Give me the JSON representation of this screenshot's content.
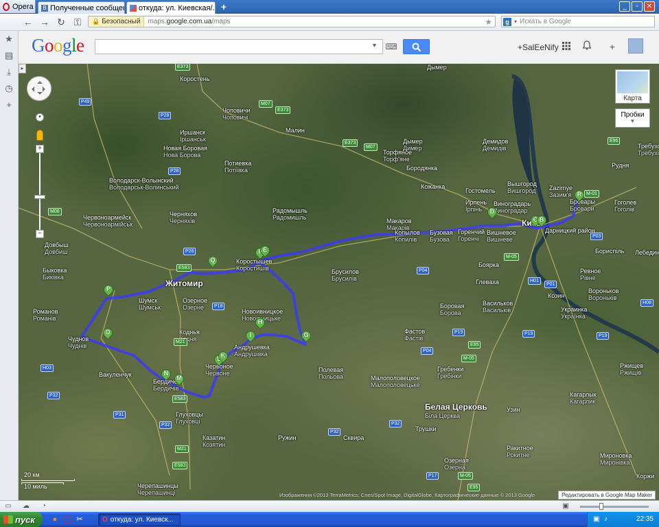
{
  "browser": {
    "menu_label": "Opera",
    "tabs": [
      {
        "label": "Полученные сообщени..."
      },
      {
        "label": "откуда: ул. Киевская/..."
      }
    ],
    "address": {
      "security_label": "Безопасный",
      "url_prefix": "maps.",
      "url_domain": "google.com.ua",
      "url_path": "/maps"
    },
    "search_placeholder": "Искать в Google"
  },
  "google_header": {
    "logo_letters": [
      "G",
      "o",
      "o",
      "g",
      "l",
      "e"
    ],
    "logo_colors": [
      "#3369e8",
      "#d50f25",
      "#eeb211",
      "#3369e8",
      "#009925",
      "#d50f25"
    ],
    "search_value": "",
    "user_link": "+SalEeNify"
  },
  "map": {
    "controls": {
      "minimap_label": "Карта",
      "traffic_label": "Пробки",
      "zoom_in": "+",
      "zoom_out": "−"
    },
    "scale": {
      "km": "20 км",
      "mi": "10 миль"
    },
    "attribution": "Изображения ©2013 TerraMetrics, Cnes/Spot Image, DigitalGlobe, Картографические данные © 2013 Google",
    "edit_link": "Редактировать в Google Map Maker",
    "route_color": "#3b3cf3",
    "labels": [
      {
        "text": "Коростень"
      },
      {
        "text": "Чоповичи",
        "sub": "Чоповичі"
      },
      {
        "text": "Малин"
      },
      {
        "text": "Иршанск",
        "sub": "Іршанськ"
      },
      {
        "text": "Новая Боровая",
        "sub": "Нова Борова"
      },
      {
        "text": "Потиевка",
        "sub": "Потіївка"
      },
      {
        "text": "Володарск-Волынский",
        "sub": "Володарськ-Волинський"
      },
      {
        "text": "Червоноармейск",
        "sub": "Червоноармійськ"
      },
      {
        "text": "Черняхов",
        "sub": "Черняхів"
      },
      {
        "text": "Радомышль",
        "sub": "Радомишль"
      },
      {
        "text": "Довбыш",
        "sub": "Довбиш"
      },
      {
        "text": "Быковка",
        "sub": "Биківка"
      },
      {
        "text": "Житомир",
        "big": true
      },
      {
        "text": "Коростышев",
        "sub": "Коростишів"
      },
      {
        "text": "Шумск",
        "sub": "Шумськ"
      },
      {
        "text": "Озерное",
        "sub": "Озерне"
      },
      {
        "text": "Романов",
        "sub": "Романів"
      },
      {
        "text": "Новоивницкое",
        "sub": "Новоівницьке"
      },
      {
        "text": "Коднья",
        "sub": "Кодня"
      },
      {
        "text": "Андрушевка",
        "sub": "Андрушівка"
      },
      {
        "text": "Чуднов",
        "sub": "Чуднів"
      },
      {
        "text": "Вакуленчук"
      },
      {
        "text": "Бердичев",
        "sub": "Бердичів"
      },
      {
        "text": "Червоное",
        "sub": "Червоне"
      },
      {
        "text": "Полевая",
        "sub": "Польова"
      },
      {
        "text": "Глуховцы",
        "sub": "Глуховці"
      },
      {
        "text": "Казатин",
        "sub": "Козятин"
      },
      {
        "text": "Ружин"
      },
      {
        "text": "Сквира"
      },
      {
        "text": "Черепашинцы",
        "sub": "Черепашинці"
      },
      {
        "text": "Брусилов",
        "sub": "Брусилів"
      },
      {
        "text": "Торфяное",
        "sub": "Торф'яне"
      },
      {
        "text": "Бородянка"
      },
      {
        "text": "Макаров",
        "sub": "Макарів"
      },
      {
        "text": "Копылов",
        "sub": "Копилів"
      },
      {
        "text": "Бузовая",
        "sub": "Бузова"
      },
      {
        "text": "Ирпень",
        "sub": "Ірпінь"
      },
      {
        "text": "Гостомель"
      },
      {
        "text": "Вышгород",
        "sub": "Вишгород"
      },
      {
        "text": "Кожанка"
      },
      {
        "text": "Горенчий",
        "sub": "Горенчі"
      },
      {
        "text": "Вишневое",
        "sub": "Вишневе"
      },
      {
        "text": "Виноградарь",
        "sub": "Виноградар"
      },
      {
        "text": "Киев",
        "big": true
      },
      {
        "text": "Дарницкий район"
      },
      {
        "text": "Бровары",
        "sub": "Бровари"
      },
      {
        "text": "Бориспіль"
      },
      {
        "text": "Боярка"
      },
      {
        "text": "Глеваха"
      },
      {
        "text": "Васильков",
        "sub": "Васильків"
      },
      {
        "text": "Козин"
      },
      {
        "text": "Украинка",
        "sub": "Українка"
      },
      {
        "text": "Боровая",
        "sub": "Борова"
      },
      {
        "text": "Фастов",
        "sub": "Фастів"
      },
      {
        "text": "Гребенки",
        "sub": "Гребінки"
      },
      {
        "text": "Малополовецкое",
        "sub": "Малополовецьке"
      },
      {
        "text": "Белая Церковь",
        "big": true,
        "sub": "Біла Церква"
      },
      {
        "text": "Трушки"
      },
      {
        "text": "Узин"
      },
      {
        "text": "Ракитное",
        "sub": "Рокитне"
      },
      {
        "text": "Озерная",
        "sub": "Озерна"
      },
      {
        "text": "Кагарлык",
        "sub": "Кагарлик"
      },
      {
        "text": "Ржищев",
        "sub": "Ржищів"
      },
      {
        "text": "Мироновка",
        "sub": "Миронівка"
      },
      {
        "text": "Дымер"
      },
      {
        "text": "Демидов",
        "sub": "Демидів"
      },
      {
        "text": "Рудня"
      },
      {
        "text": "Гоголев",
        "sub": "Гоголів"
      },
      {
        "text": "Требухов",
        "sub": "Требухів"
      },
      {
        "text": "Ревное",
        "sub": "Рівне"
      },
      {
        "text": "Вороньков",
        "sub": "Вороньків"
      },
      {
        "text": "Лебедин"
      },
      {
        "text": "Коржи"
      },
      {
        "text": "Zazimye",
        "sub": "Зазим'я"
      },
      {
        "text": "Дымер",
        "sub": "Димер"
      }
    ],
    "road_shields": [
      {
        "text": "E373",
        "kind": "g"
      },
      {
        "text": "M07",
        "kind": "g"
      },
      {
        "text": "E373",
        "kind": "g"
      },
      {
        "text": "M07",
        "kind": "g"
      },
      {
        "text": "E373",
        "kind": "g"
      },
      {
        "text": "P49",
        "kind": "b"
      },
      {
        "text": "P28",
        "kind": "b"
      },
      {
        "text": "P28",
        "kind": "b"
      },
      {
        "text": "M06",
        "kind": "g"
      },
      {
        "text": "P28",
        "kind": "b"
      },
      {
        "text": "E583",
        "kind": "g"
      },
      {
        "text": "P18",
        "kind": "b"
      },
      {
        "text": "M21",
        "kind": "g"
      },
      {
        "text": "H03",
        "kind": "b"
      },
      {
        "text": "P32",
        "kind": "b"
      },
      {
        "text": "P31",
        "kind": "b"
      },
      {
        "text": "E583",
        "kind": "g"
      },
      {
        "text": "P32",
        "kind": "b"
      },
      {
        "text": "M21",
        "kind": "g"
      },
      {
        "text": "E583",
        "kind": "g"
      },
      {
        "text": "P04",
        "kind": "b"
      },
      {
        "text": "P04",
        "kind": "b"
      },
      {
        "text": "P19",
        "kind": "b"
      },
      {
        "text": "E95",
        "kind": "g"
      },
      {
        "text": "M-05",
        "kind": "g"
      },
      {
        "text": "P32",
        "kind": "b"
      },
      {
        "text": "P32",
        "kind": "b"
      },
      {
        "text": "P17",
        "kind": "b"
      },
      {
        "text": "M-05",
        "kind": "g"
      },
      {
        "text": "E95",
        "kind": "g"
      },
      {
        "text": "H01",
        "kind": "b"
      },
      {
        "text": "P19",
        "kind": "b"
      },
      {
        "text": "P19",
        "kind": "b"
      },
      {
        "text": "P03",
        "kind": "b"
      },
      {
        "text": "H08",
        "kind": "b"
      },
      {
        "text": "E95",
        "kind": "g"
      },
      {
        "text": "M-01",
        "kind": "g"
      },
      {
        "text": "M-05",
        "kind": "g"
      },
      {
        "text": "P01",
        "kind": "b"
      }
    ],
    "markers": [
      "R",
      "D",
      "C",
      "B",
      "F",
      "E",
      "Q",
      "P",
      "O",
      "H",
      "I",
      "G",
      "L",
      "K",
      "N",
      "M"
    ]
  },
  "statusbar": {},
  "taskbar": {
    "start_label": "пуск",
    "task_label": "откуда: ул. Киевск...",
    "clock": "22:35"
  }
}
